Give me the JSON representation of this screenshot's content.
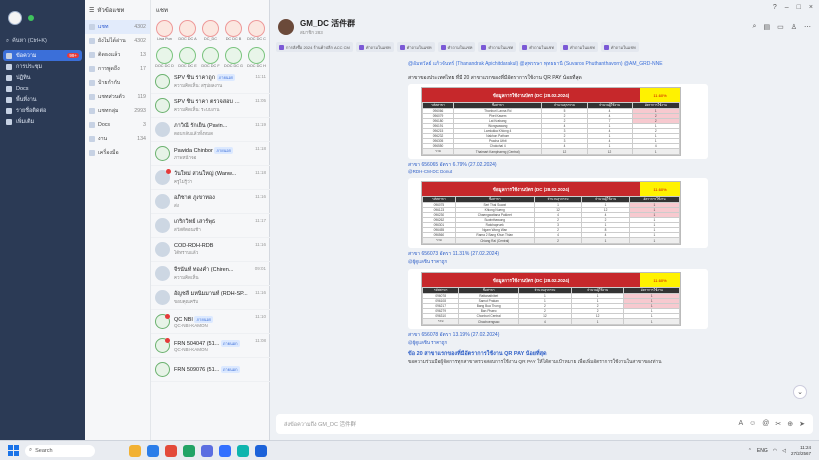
{
  "rail": {
    "search_label": "ค้นหา (Ctrl+K)",
    "items": [
      {
        "label": "ข้อความ",
        "badge": "99+",
        "active": true
      },
      {
        "label": "การประชุม",
        "badge": ""
      },
      {
        "label": "ปฏิทิน",
        "badge": ""
      },
      {
        "label": "Docs",
        "badge": ""
      },
      {
        "label": "พื้นที่งาน",
        "badge": ""
      },
      {
        "label": "รายชื่อติดต่อ",
        "badge": ""
      },
      {
        "label": "เพิ่มเติม",
        "badge": ""
      }
    ]
  },
  "categories": {
    "header": "หัวข้อแชท",
    "rows": [
      {
        "label": "แชท",
        "count": "4302",
        "active": true
      },
      {
        "label": "ยังไม่ได้อ่าน",
        "count": "4302"
      },
      {
        "label": "ติดธงแล้ว",
        "count": "13"
      },
      {
        "label": "การพูดถึง",
        "count": "17"
      },
      {
        "label": "ป้ายกำกับ",
        "count": ""
      },
      {
        "label": "แชทส่วนตัว",
        "count": "119"
      },
      {
        "label": "แชทกลุ่ม",
        "count": "2993"
      },
      {
        "label": "Docs",
        "count": "3"
      },
      {
        "label": "งาน",
        "count": "134"
      },
      {
        "label": "เครื่องมือ",
        "count": ""
      }
    ]
  },
  "chatlist": {
    "header": "แชท",
    "stories": [
      "Lisa Pun",
      "DOC DC A",
      "DC_DC",
      "DC DC B",
      "DOC DC C",
      "DOC DC D",
      "DOC DC E",
      "DOC DC F",
      "DOC DC G",
      "DOC DC H"
    ],
    "rows": [
      {
        "name": "SPV ชิน ราคาถูก",
        "tag": "ภายนอก",
        "preview": "ความคิดเห็น: สรุปผลงาน",
        "time": "11:11"
      },
      {
        "name": "SPV ชิน ราคา ตรวจสอบ",
        "tag": "ภายนอก",
        "preview": "ความคิดเห็น: ระบบงาน",
        "time": "11:05"
      },
      {
        "name": "ภาวิณี รักเย็น (Pavin...",
        "tag": "",
        "preview": "ตอบกลับแล้วทั้งหมด",
        "time": "11:19"
      },
      {
        "name": "Pawida Chinbor",
        "tag": "ภายนอก",
        "preview": "ภาพหน้าจอ",
        "time": "11:18"
      },
      {
        "name": "วันใหม่ สวนใหญ่ (Wanw...",
        "tag": "",
        "preview": "ครูไม่รู้ว่า",
        "time": "11:18"
      },
      {
        "name": "อภิชาต ภูเขาทอง",
        "tag": "",
        "preview": "ส่ง",
        "time": "11:16"
      },
      {
        "name": "เกริกวิทย์ เสาร์พุธ",
        "tag": "",
        "preview": "สวัสดีตอนเช้า",
        "time": "11:17"
      },
      {
        "name": "COD-RDH-RDB",
        "tag": "",
        "preview": "ได้ทราบแล้ว",
        "time": "11:16"
      },
      {
        "name": "จีรนันท์ ทองคำ (Chiren...",
        "tag": "",
        "preview": "ความคิดเห็น",
        "time": "09:01"
      },
      {
        "name": "อัญชลี มหนิมมานท์ (RDH-SP...",
        "tag": "",
        "preview": "ขอบคุณครับ",
        "time": "11:16"
      },
      {
        "name": "QC NBI",
        "tag": "ภายนอก",
        "preview": "QC-NBI-KAMON",
        "time": "11:10"
      },
      {
        "name": "FRN 504047 (51...",
        "tag": "ภายนอก",
        "preview": "QC-NBI-KAMON",
        "time": "11:08"
      },
      {
        "name": "FRN 509076 (51...",
        "tag": "ภายนอก",
        "preview": "",
        "time": ""
      }
    ]
  },
  "chat": {
    "title": "GM_DC 活件群",
    "subtitle": "สมาชิก 283",
    "pins": [
      "การสั่งซื้อ 2024 ร้านค้าปลีก ACC CM",
      "คำถามในแชท",
      "คำถามในแชท",
      "คำถามในแชท",
      "คำถามในแชท",
      "คำถามในแชท",
      "คำถามในแชท",
      "คำถามในแชท"
    ],
    "mention": "@อัมพวัลย์ แก้วจันทร์ (Thanandrak Apichitdarakul) @สุพรรษา พุทธธานี (Suvaros Phuthanthavorn) @AM_GRD-NNE",
    "intro": "สาขาของประเทศไทย ที่มี 20 สาขาแรกของที่มีอัตราการใช้งาน QR PAY น้อยที่สุด",
    "sheets": [
      {
        "title": "ข้อมูลการใช้งานบัตร (DC (28.02.2024)",
        "badge": "11.60%",
        "headers": [
          "รหัสสาขา",
          "ชื่อสาขา",
          "จำนวนธุรกรรม",
          "จำนวนผู้ใช้งาน",
          "อัตราการใช้งาน"
        ],
        "rows": [
          [
            "096066",
            "Thonburi Lanna Rd",
            "5",
            "4",
            "1"
          ],
          [
            "096079",
            "Phet Kasem",
            "2",
            "4",
            "2"
          ],
          [
            "096180",
            "Lat Krabang",
            "2",
            "7",
            "2"
          ],
          [
            "096191",
            "Wongsawang",
            "4",
            "1",
            "1"
          ],
          [
            "096215",
            "Lamlukka Khlong 4",
            "3",
            "4",
            "2"
          ],
          [
            "096232",
            "Nakhon Pathom",
            "2",
            "1",
            "1"
          ],
          [
            "096305",
            "Pracha Uthit",
            "3",
            "4",
            "1"
          ],
          [
            "096550",
            "Chokchai 4",
            "4",
            "1",
            "4"
          ],
          [
            "รวม",
            "Thaimart Kamphaeng (Central)",
            "12",
            "12",
            "1"
          ]
        ],
        "caption": "สาขา 656065 อัตรา 6.79% (27.02.2024)",
        "author": "@RDH-CM-DC Donut"
      },
      {
        "title": "ข้อมูลการใช้งานบัตร (DC (28.02.2024)",
        "badge": "11.60%",
        "headers": [
          "รหัสสาขา",
          "ชื่อสาขา",
          "จำนวนธุรกรรม",
          "จำนวนผู้ใช้งาน",
          "อัตราการใช้งาน"
        ],
        "rows": [
          [
            "096075",
            "Seri Thai Suwat",
            "1",
            "1",
            "1"
          ],
          [
            "096123",
            "Khlong Nueng",
            "12",
            "12",
            "1"
          ],
          [
            "096230",
            "Chaengwattana Pakkret",
            "4",
            "4",
            "1"
          ],
          [
            "096262",
            "Suwinthawong",
            "2",
            "2",
            "1"
          ],
          [
            "096301",
            "Ratchapruek",
            "3",
            "1",
            "1"
          ],
          [
            "096455",
            "Ngam Wong Wan",
            "2",
            "8",
            "1"
          ],
          [
            "096560",
            "Rama 2 Bang Khun Thian",
            "4",
            "4",
            "1"
          ],
          [
            "รวม",
            "Chiang Rai (Central)",
            "2",
            "1",
            "1"
          ]
        ],
        "caption": "สาขา 656073 อัตรา 11.31% (27.02.2024)",
        "author": "@ผู้ดูแลชิน ราคาถูก"
      },
      {
        "title": "ข้อมูลการใช้งานบัตร (DC (28.02.2024)",
        "badge": "11.60%",
        "headers": [
          "รหัสสาขา",
          "ชื่อสาขา",
          "จำนวนธุรกรรม",
          "จำนวนผู้ใช้งาน",
          "อัตราการใช้งาน"
        ],
        "rows": [
          [
            "096078",
            "Rattanathibet",
            "1",
            "1",
            "1"
          ],
          [
            "096108",
            "Samut Prakan",
            "1",
            "1",
            "1"
          ],
          [
            "096217",
            "Bang Bua Thong",
            "2",
            "2",
            "1"
          ],
          [
            "096279",
            "Ban Phaeo",
            "2",
            "2",
            "1"
          ],
          [
            "096310",
            "Chonburi Central",
            "12",
            "12",
            "1"
          ],
          [
            "รวม",
            "Chachoengsao",
            "4",
            "1",
            "1"
          ]
        ],
        "caption": "สาขา 656078 อัตรา 13.19% (27.02.2024)",
        "author": "@ผู้ดูแลชิน ราคาถูก"
      }
    ],
    "final_title": "ข้อ 20 สาขาแรกของที่มีอัตราการใช้งาน QR PAY น้อยที่สุด",
    "final_body": "ขอความร่วมมือผู้จัดการทุกสาขาตรวจสอบการใช้งาน QR PAY ให้ได้ตามเป้าหมาย เพื่อเพิ่มอัตราการใช้งานในสาขาของท่าน",
    "input_placeholder": "ส่งข้อความถึง GM_DC 活件群"
  },
  "taskbar": {
    "search": "Search",
    "lang": "ENG",
    "time": "11:24",
    "date": "27/2/2567"
  }
}
